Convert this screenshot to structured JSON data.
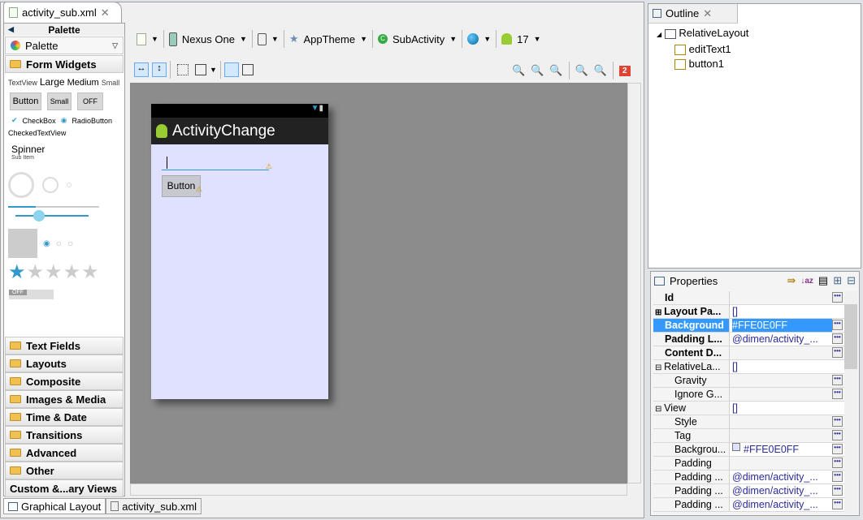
{
  "editor": {
    "tab": "activity_sub.xml"
  },
  "palette": {
    "header": "Palette",
    "dropdown": "Palette",
    "open_category": "Form Widgets",
    "textviews": [
      "TextView",
      "Large",
      "Medium",
      "Small"
    ],
    "buttons": [
      "Button",
      "Small",
      "OFF"
    ],
    "checkbox": "CheckBox",
    "radio": "RadioButton",
    "checked_text": "CheckedTextView",
    "spinner": "Spinner",
    "spinner_sub": "Sub Item",
    "switch": "OFF",
    "rating": {
      "value": 1,
      "max": 5
    },
    "categories": [
      "Text Fields",
      "Layouts",
      "Composite",
      "Images & Media",
      "Time & Date",
      "Transitions",
      "Advanced",
      "Other",
      "Custom &...ary Views"
    ]
  },
  "toolbar": {
    "device": "Nexus One",
    "theme": "AppTheme",
    "activity": "SubActivity",
    "api": "17",
    "error_count": "2"
  },
  "phone": {
    "title": "ActivityChange",
    "button": "Button",
    "background": "#E0E0FF"
  },
  "bottom_tabs": [
    "Graphical Layout",
    "activity_sub.xml"
  ],
  "outline": {
    "title": "Outline",
    "root": "RelativeLayout",
    "children": [
      "editText1",
      "button1"
    ]
  },
  "properties": {
    "title": "Properties",
    "rows": [
      {
        "k": "Id",
        "v": "",
        "bold": true
      },
      {
        "k": "Layout Pa...",
        "v": "[]",
        "bold": true,
        "exp": "+"
      },
      {
        "k": "Background",
        "v": "#FFE0E0FF",
        "bold": true,
        "sel": true
      },
      {
        "k": "Padding L...",
        "v": "@dimen/activity_...",
        "bold": true
      },
      {
        "k": "Content D...",
        "v": "",
        "bold": true
      },
      {
        "k": "RelativeLa...",
        "v": "[]",
        "exp": "-"
      },
      {
        "k": "Gravity",
        "v": "",
        "ind": true
      },
      {
        "k": "Ignore G...",
        "v": "",
        "ind": true
      },
      {
        "k": "View",
        "v": "[]",
        "exp": "-"
      },
      {
        "k": "Style",
        "v": "",
        "ind": true
      },
      {
        "k": "Tag",
        "v": "",
        "ind": true
      },
      {
        "k": "Backgrou...",
        "v": "#FFE0E0FF",
        "ind": true,
        "swatch": true
      },
      {
        "k": "Padding",
        "v": "",
        "ind": true
      },
      {
        "k": "Padding ...",
        "v": "@dimen/activity_...",
        "ind": true
      },
      {
        "k": "Padding ...",
        "v": "@dimen/activity_...",
        "ind": true
      },
      {
        "k": "Padding ...",
        "v": "@dimen/activity_...",
        "ind": true
      }
    ]
  }
}
